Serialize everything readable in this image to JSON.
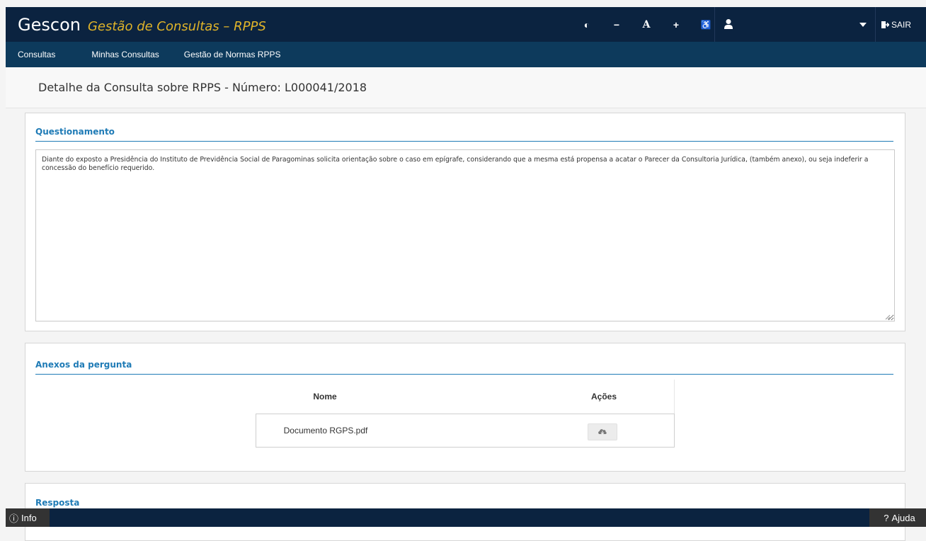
{
  "header": {
    "brand": "Gescon",
    "subtitle": "Gestão de Consultas – RPPS",
    "tools": [
      {
        "icon": "contrast-icon",
        "glyph": "◐"
      },
      {
        "icon": "decrease-font-icon",
        "glyph": "−"
      },
      {
        "icon": "default-font-icon",
        "glyph": "A"
      },
      {
        "icon": "increase-font-icon",
        "glyph": "+"
      },
      {
        "icon": "accessibility-icon",
        "glyph": "♿"
      }
    ],
    "user_icon": "user-icon",
    "logout_label": "SAIR"
  },
  "nav": {
    "items": [
      "Consultas",
      "Minhas Consultas",
      "Gestão de Normas RPPS"
    ]
  },
  "page": {
    "title": "Detalhe da Consulta sobre RPPS - Número: L000041/2018"
  },
  "questionamento": {
    "title": "Questionamento",
    "text": "Diante do exposto a Presidência do Instituto de Previdência Social de Paragominas solicita orientação sobre o caso em epígrafe, considerando que a mesma está propensa a acatar o Parecer da Consultoria Jurídica, (também anexo), ou seja indeferir a concessão do benefício requerido."
  },
  "anexos": {
    "title": "Anexos da pergunta",
    "columns": [
      "Nome",
      "",
      "Ações"
    ],
    "rows": [
      {
        "nome": "Documento RGPS.pdf",
        "action_icon": "download-cloud-icon"
      }
    ]
  },
  "resposta": {
    "title": "Resposta"
  },
  "footer": {
    "info_label": "Info",
    "help_label": "Ajuda",
    "info_glyph": "ⓘ",
    "help_glyph": "⓪"
  },
  "colors": {
    "header_bg": "#0b2340",
    "nav_bg": "#0d3a5c",
    "accent": "#1f7bb6",
    "brand_sub": "#e0b429"
  }
}
